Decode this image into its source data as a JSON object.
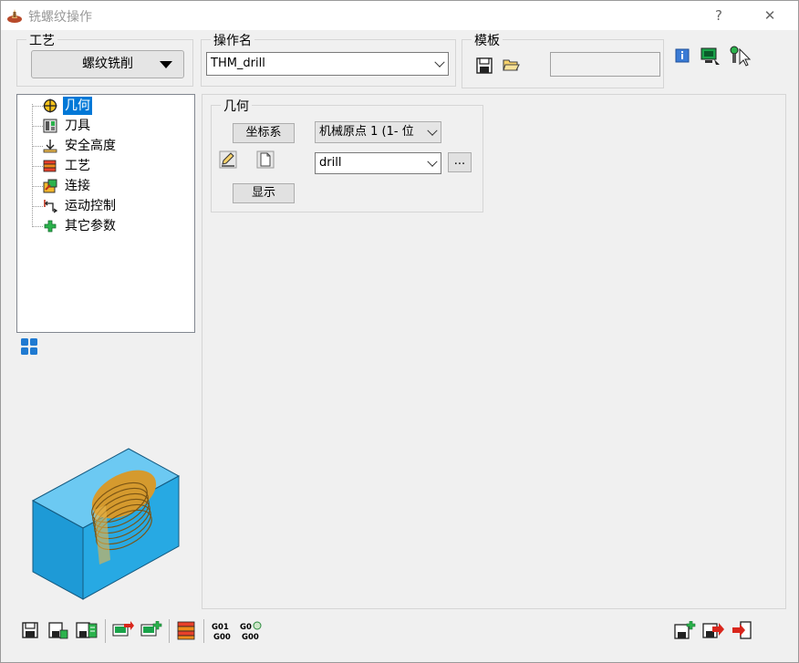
{
  "window": {
    "title": "铣螺纹操作",
    "help_label": "?",
    "close_label": "✕"
  },
  "process": {
    "label": "工艺",
    "value": "螺纹铣削"
  },
  "operation": {
    "label": "操作名",
    "value": "THM_drill"
  },
  "template": {
    "label": "模板",
    "value": ""
  },
  "tree": {
    "items": [
      {
        "label": "几何",
        "icon": "geometry-icon"
      },
      {
        "label": "刀具",
        "icon": "tool-icon"
      },
      {
        "label": "安全高度",
        "icon": "safe-height-icon"
      },
      {
        "label": "工艺",
        "icon": "technology-icon"
      },
      {
        "label": "连接",
        "icon": "link-icon"
      },
      {
        "label": "运动控制",
        "icon": "motion-control-icon"
      },
      {
        "label": "其它参数",
        "icon": "other-params-icon"
      }
    ]
  },
  "geometry": {
    "label": "几何",
    "coord_button": "坐标系",
    "coord_value": "机械原点 1 (1- 位",
    "model_value": "drill",
    "browse_button": "...",
    "show_button": "显示"
  },
  "colors": {
    "selection": "#0078d7",
    "part_blue": "#29aae1",
    "thread_gold": "#e8b64a"
  }
}
